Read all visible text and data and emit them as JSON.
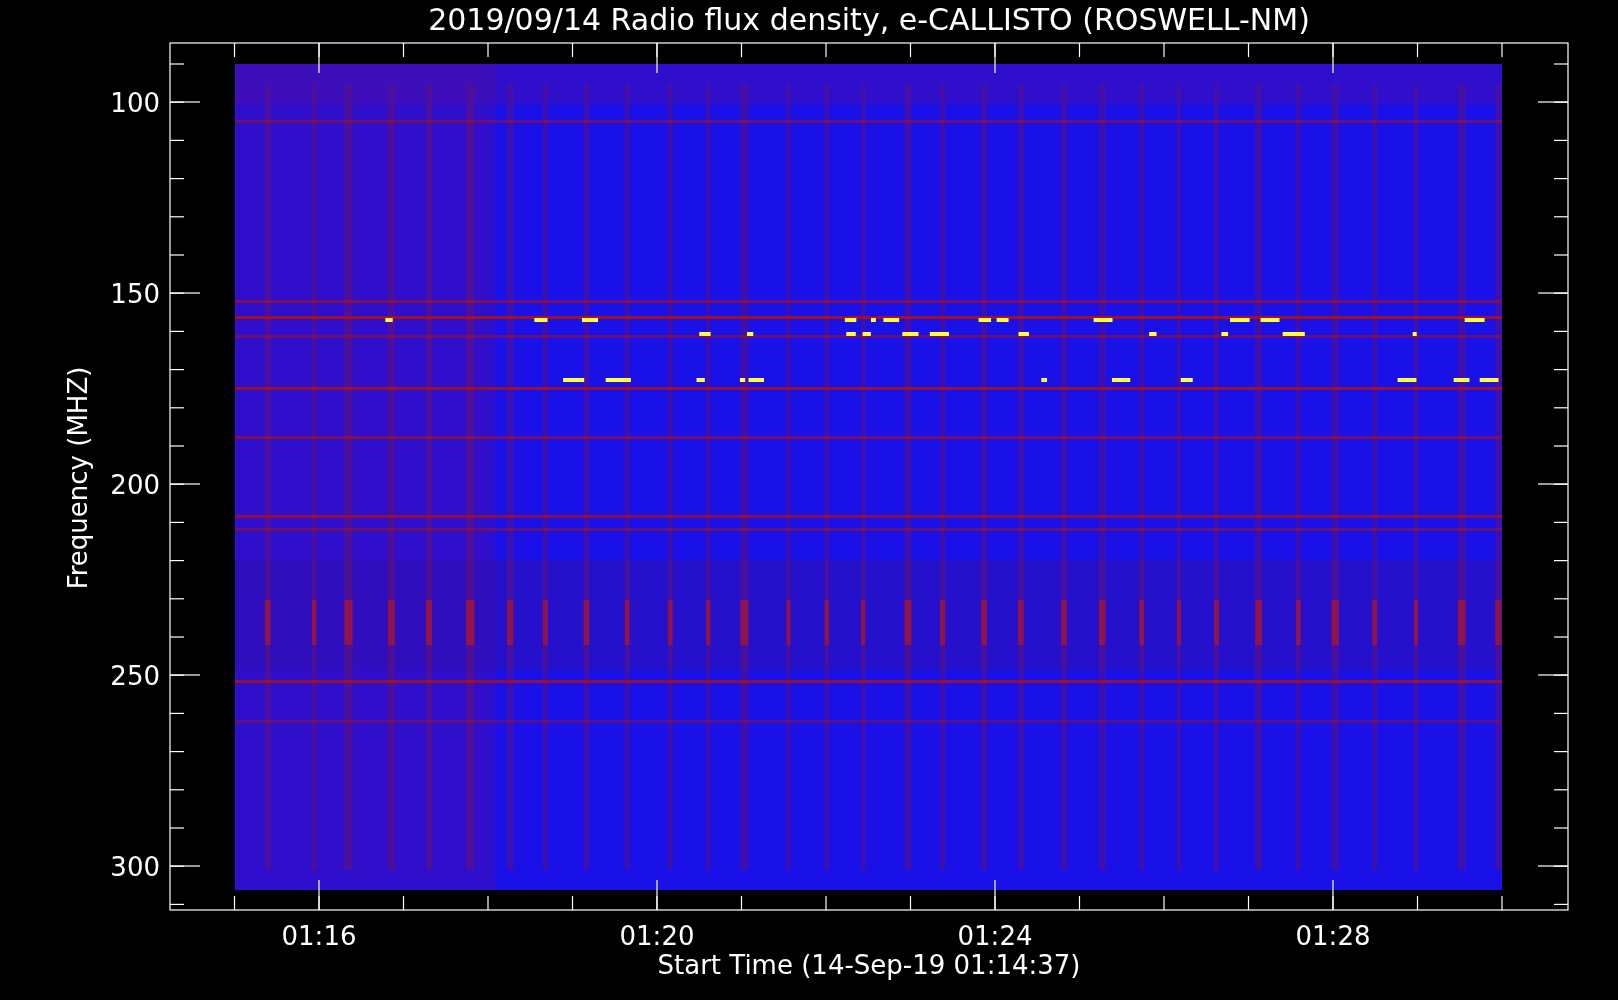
{
  "title": "2019/09/14  Radio flux density, e-CALLISTO (ROSWELL-NM)",
  "y_axis": {
    "label": "Frequency (MHZ)",
    "ticks": [
      "100",
      "150",
      "200",
      "250",
      "300"
    ]
  },
  "x_axis": {
    "label": "Start Time (14-Sep-19 01:14:37)",
    "ticks": [
      "01:16",
      "01:20",
      "01:24",
      "01:28"
    ]
  }
}
